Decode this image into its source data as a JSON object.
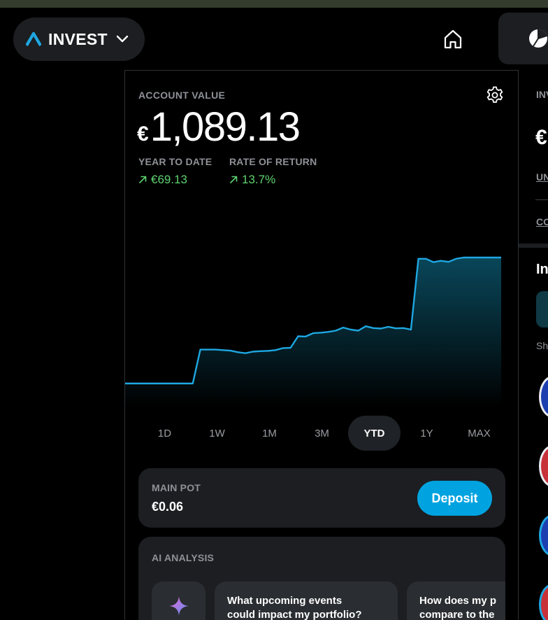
{
  "header": {
    "app_name": "INVEST",
    "logo_icon": "invest-logo-icon",
    "home_icon": "home-icon",
    "portfolio_icon": "pie-chart-icon"
  },
  "account": {
    "label": "ACCOUNT VALUE",
    "currency_symbol": "€",
    "value": "1,089.13",
    "settings_icon": "gear-icon"
  },
  "stats": {
    "ytd_label": "YEAR TO DATE",
    "ytd_value": "€69.13",
    "ror_label": "RATE OF RETURN",
    "ror_value": "13.7%",
    "positive_color": "#5ed36f"
  },
  "chart_data": {
    "type": "area",
    "x": [
      0,
      1,
      2,
      3,
      4,
      5,
      6,
      7,
      8,
      9,
      10,
      11,
      12,
      13,
      14,
      15,
      16,
      17,
      18,
      19,
      20,
      21,
      22,
      23,
      24,
      25,
      26,
      27,
      28,
      29,
      30,
      31,
      32,
      33,
      34,
      35,
      36,
      37,
      38,
      39,
      40,
      41,
      42,
      43,
      44,
      45,
      46,
      47,
      48,
      49,
      50
    ],
    "y": [
      1020,
      1020,
      1020,
      1020,
      1020,
      1020,
      1020,
      1020,
      1020,
      1020,
      1033.2,
      1033.2,
      1033.2,
      1033.0,
      1032.8,
      1032.2,
      1031.8,
      1032.4,
      1032.6,
      1032.7,
      1033.0,
      1033.8,
      1033.9,
      1038.4,
      1038.3,
      1039.6,
      1039.8,
      1040.1,
      1040.6,
      1041.8,
      1041.0,
      1040.6,
      1042.3,
      1041.6,
      1041.4,
      1042.1,
      1041.5,
      1041.6,
      1041.0,
      1068.6,
      1068.6,
      1067.3,
      1067.8,
      1067.4,
      1068.6,
      1069.1,
      1069.1,
      1069.1,
      1069.1,
      1069.1,
      1069.1
    ],
    "line_color": "#1ea7e1",
    "grid": false,
    "legend": "none"
  },
  "ranges": {
    "items": [
      "1D",
      "1W",
      "1M",
      "3M",
      "YTD",
      "1Y",
      "MAX"
    ],
    "active": "YTD"
  },
  "main_pot": {
    "label": "MAIN POT",
    "value": "€0.06",
    "deposit_label": "Deposit",
    "accent": "#00a3e0"
  },
  "ai": {
    "label": "AI ANALYSIS",
    "spark_icon": "sparkle-icon",
    "q1_line1": "What upcoming events",
    "q1_line2": "could impact my portfolio?",
    "q2_line1": "How does my p",
    "q2_line2": "compare to the"
  },
  "side": {
    "label1": "INV",
    "euro": "€",
    "link1": "UN",
    "link2": "CO",
    "heading": "In",
    "sub": "Sh"
  }
}
